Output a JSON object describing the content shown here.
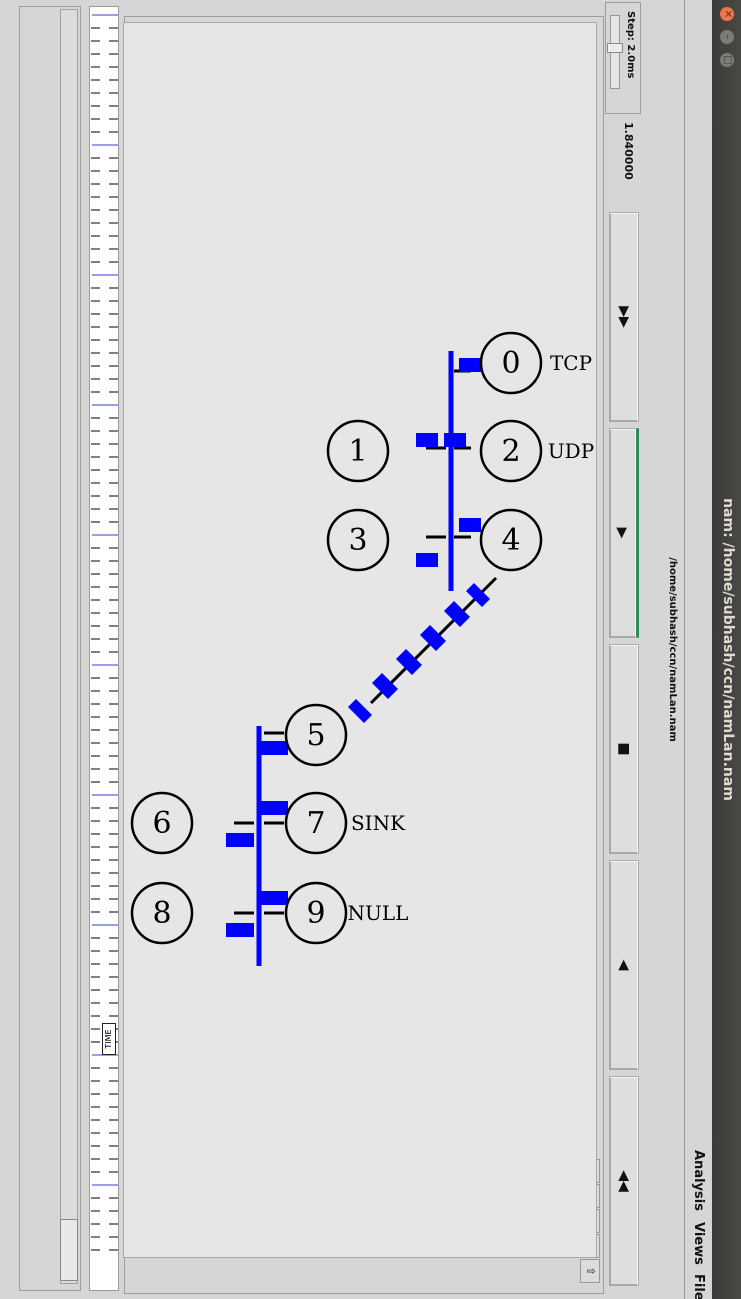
{
  "window": {
    "title": "nam: /home/subhash/ccn/namLan.nam",
    "file_path": "/home/subhash/ccn/namLan.nam"
  },
  "menu": [
    {
      "label": "File"
    },
    {
      "label": "Views"
    },
    {
      "label": "Analysis"
    }
  ],
  "controls": {
    "rewind": "◀◀",
    "back": "◀",
    "stop": "■",
    "play": "▶",
    "fastforward": "▶▶",
    "time": "1.840000",
    "step": "Step: 2.0ms"
  },
  "toolbar_icons": [
    "zoom-in-icon",
    "zoom-out-icon",
    "edit-icon",
    "small-circle-icon",
    "large-circle-icon"
  ],
  "time_marker_label": "TIME",
  "network": {
    "nodes": [
      "0",
      "1",
      "2",
      "3",
      "4",
      "5",
      "6",
      "7",
      "8",
      "9"
    ],
    "labels": [
      "TCP",
      "UDP",
      "SINK",
      "NULL"
    ]
  },
  "colors": {
    "packet": "#0000ff",
    "lan_bus": "#0000ff",
    "active_button": "#2e8b57"
  }
}
